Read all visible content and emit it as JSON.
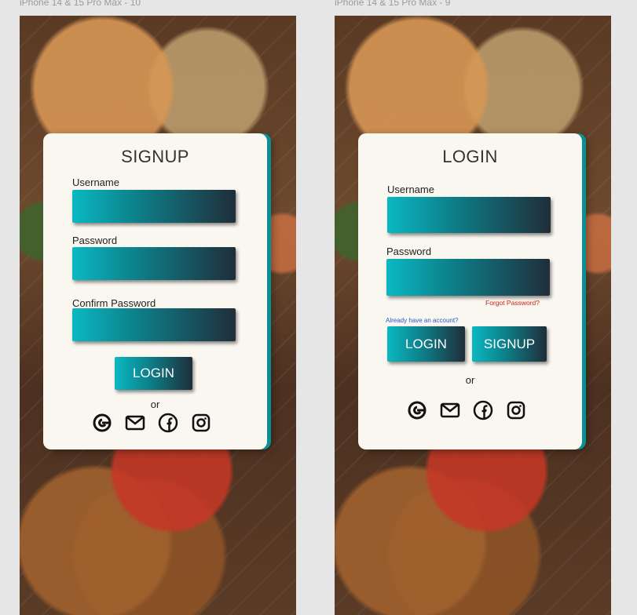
{
  "frames": [
    {
      "name": "iPhone 14 & 15 Pro Max - 10"
    },
    {
      "name": "iPhone 14 & 15 Pro Max - 9"
    }
  ],
  "signup": {
    "title": "SIGNUP",
    "username_label": "Username",
    "password_label": "Password",
    "confirm_label": "Confirm Password",
    "username_value": "",
    "password_value": "",
    "confirm_value": "",
    "login_button": "LOGIN",
    "or_text": "or",
    "social": [
      "google-icon",
      "mail-icon",
      "facebook-icon",
      "instagram-icon"
    ]
  },
  "login": {
    "title": "LOGIN",
    "username_label": "Username",
    "password_label": "Password",
    "username_value": "",
    "password_value": "",
    "forgot": "Forgot Password?",
    "already": "Already have an account?",
    "login_button": "LOGIN",
    "signup_button": "SIGNUP",
    "or_text": "or",
    "social": [
      "google-icon",
      "mail-icon",
      "facebook-icon",
      "instagram-icon"
    ]
  },
  "colors": {
    "accent": "#0a8f97",
    "gradient_start": "#0ab8c2",
    "gradient_end": "#1f2e3a",
    "card": "#faf7f0",
    "forgot": "#d0201a",
    "link": "#2a56d6"
  }
}
